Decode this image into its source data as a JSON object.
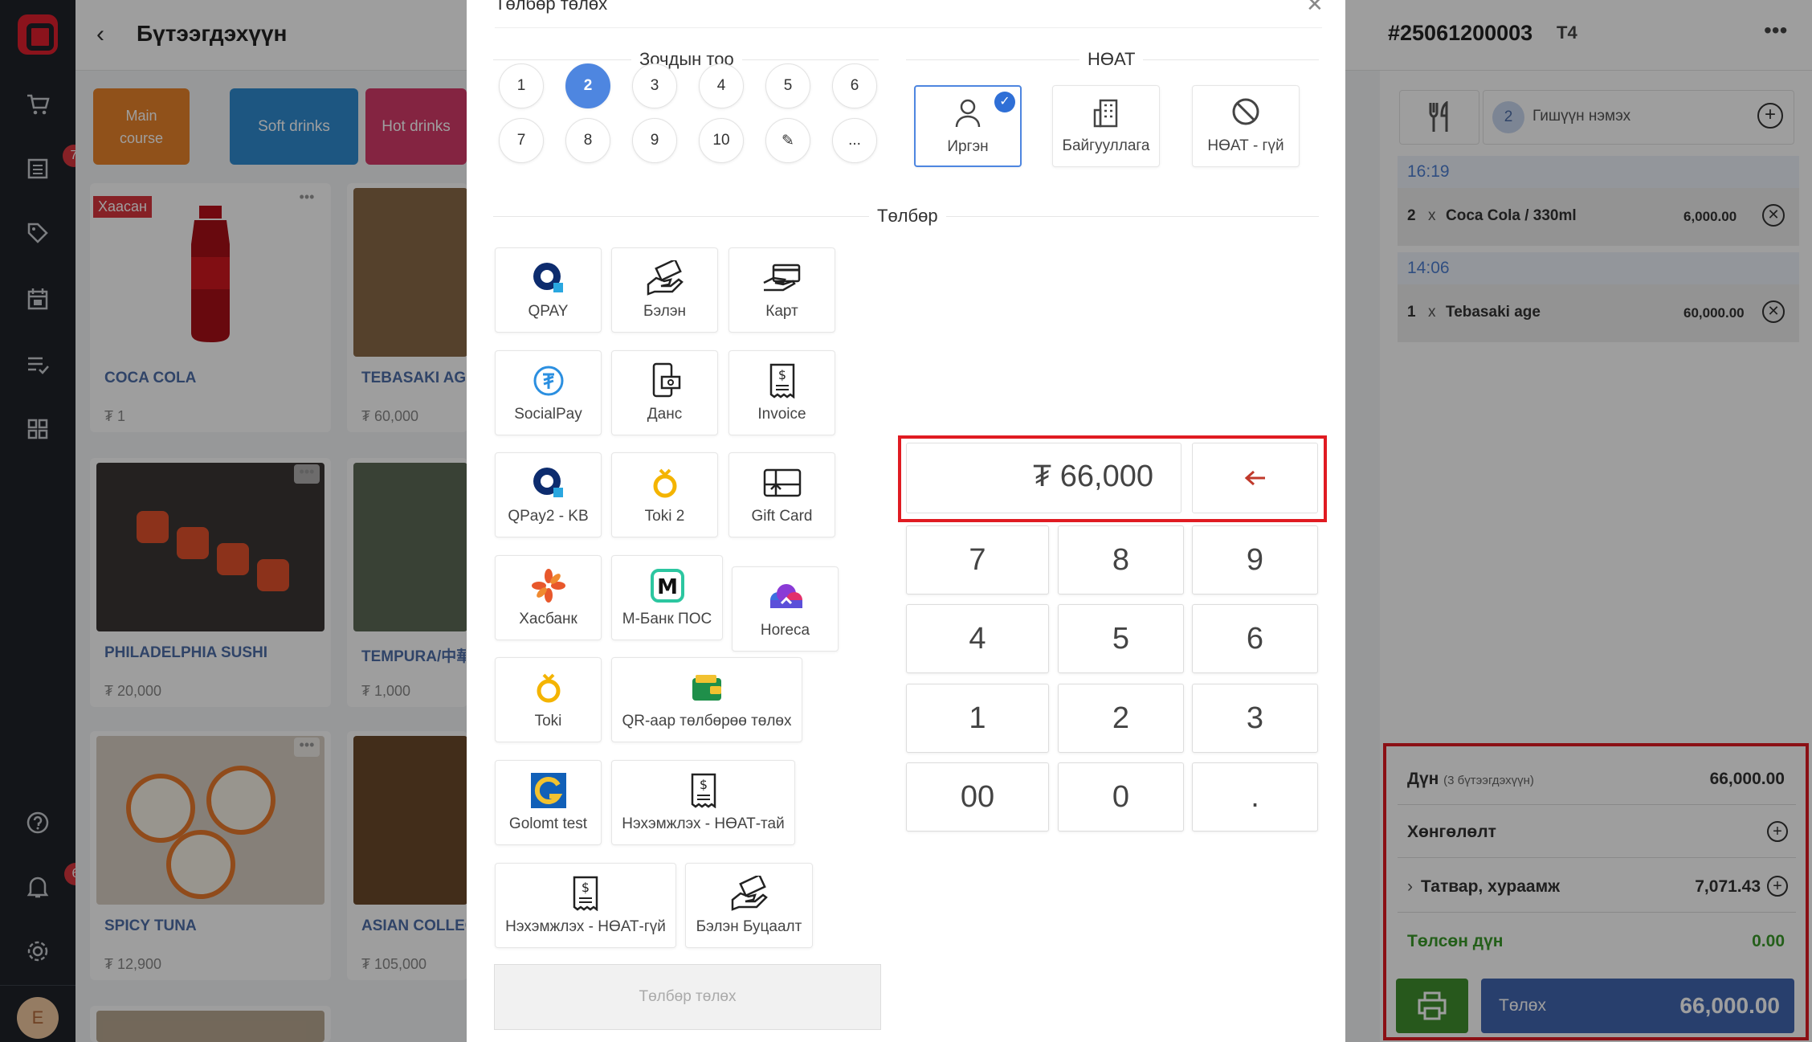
{
  "background": {
    "page_title": "Бүтээгдэхүүн",
    "back_icon": "chevron-left-icon",
    "rail": {
      "order_badge": "7",
      "notif_badge": "6",
      "avatar_initial": "E"
    },
    "categories": [
      {
        "label": "Main course",
        "color": "#e8832a"
      },
      {
        "label": "Soft drinks",
        "color": "#2f8bd0"
      },
      {
        "label": "Hot drinks",
        "color": "#d53a6a"
      }
    ],
    "products": [
      {
        "name": "COCA COLA",
        "price": "₮ 1",
        "tag": "Хаасан"
      },
      {
        "name": "TEBASAKI AGE",
        "price": "₮ 60,000"
      },
      {
        "name": "PHILADELPHIA SUSHI",
        "price": "₮ 20,000"
      },
      {
        "name": "TEMPURA/中華",
        "price": "₮ 1,000"
      },
      {
        "name": "SPICY TUNA",
        "price": "₮ 12,900"
      },
      {
        "name": "ASIAN COLLECTION",
        "price": "₮ 105,000"
      }
    ]
  },
  "modal": {
    "title": "Төлбөр төлөх",
    "guest_section": "Зочдын тоо",
    "guest_buttons": [
      "1",
      "2",
      "3",
      "4",
      "5",
      "6",
      "7",
      "8",
      "9",
      "10",
      "✎",
      "..."
    ],
    "guest_selected": "2",
    "vat_section": "НӨАТ",
    "vat_options": [
      {
        "label": "Иргэн",
        "icon": "person-icon",
        "selected": true
      },
      {
        "label": "Байгууллага",
        "icon": "building-icon",
        "selected": false
      },
      {
        "label": "НӨАТ - гүй",
        "icon": "ban-icon",
        "selected": false
      }
    ],
    "payment_section": "Төлбөр",
    "payment_methods": [
      {
        "label": "QPAY",
        "icon": "qpay-icon"
      },
      {
        "label": "Бэлэн",
        "icon": "cash-hand-icon"
      },
      {
        "label": "Карт",
        "icon": "card-hand-icon"
      },
      {
        "label": "SocialPay",
        "icon": "socialpay-icon"
      },
      {
        "label": "Данс",
        "icon": "bank-phone-icon"
      },
      {
        "label": "Invoice",
        "icon": "invoice-icon"
      },
      {
        "label": "QPay2 - KB",
        "icon": "qpay-icon"
      },
      {
        "label": "Toki 2",
        "icon": "toki-icon"
      },
      {
        "label": "Gift Card",
        "icon": "gift-card-icon"
      },
      {
        "label": "Хасбанк",
        "icon": "xacbank-icon"
      },
      {
        "label": "М-Банк ПОС",
        "icon": "mbank-icon"
      },
      {
        "label": "Horeca",
        "icon": "horeca-icon"
      },
      {
        "label": "Toki",
        "icon": "toki-icon"
      },
      {
        "label": "QR-аар төлбөрөө төлөх",
        "icon": "wallet-icon"
      },
      {
        "label": "Golomt test",
        "icon": "golomt-icon"
      },
      {
        "label": "Нэхэмжлэх - НӨАТ-тай",
        "icon": "invoice-icon"
      },
      {
        "label": "Нэхэмжлэх - НӨАТ-гүй",
        "icon": "invoice-icon"
      },
      {
        "label": "Бэлэн Буцаалт",
        "icon": "cash-hand-icon"
      }
    ],
    "submit_label": "Төлбөр төлөх",
    "amount": "₮ 66,000",
    "keypad": [
      "7",
      "8",
      "9",
      "4",
      "5",
      "6",
      "1",
      "2",
      "3",
      "00",
      "0",
      "."
    ]
  },
  "order": {
    "number": "#25061200003",
    "table": "T4",
    "guest_count": "2",
    "guest_add_label": "Гишүүн нэмэх",
    "groups": [
      {
        "time": "16:19",
        "items": [
          {
            "qty": "2",
            "name": "Coca Cola / 330ml",
            "price": "6,000.00"
          }
        ]
      },
      {
        "time": "14:06",
        "items": [
          {
            "qty": "1",
            "name": "Tebasaki age",
            "price": "60,000.00"
          }
        ]
      }
    ],
    "x_mark": "x",
    "summary": {
      "total_label": "Дүн",
      "total_sub": "(3 бүтээгдэхүүн)",
      "total_value": "66,000.00",
      "discount_label": "Хөнгөлөлт",
      "tax_label": "Татвар, хураамж",
      "tax_value": "7,071.43",
      "paid_label": "Төлсөн дүн",
      "paid_value": "0.00",
      "pay_label": "Төлөх",
      "pay_value": "66,000.00"
    }
  },
  "colors": {
    "accent": "#4e86e0",
    "highlight": "#e01b22",
    "paid": "#3a9a2a",
    "pay_button": "#4266b0"
  }
}
